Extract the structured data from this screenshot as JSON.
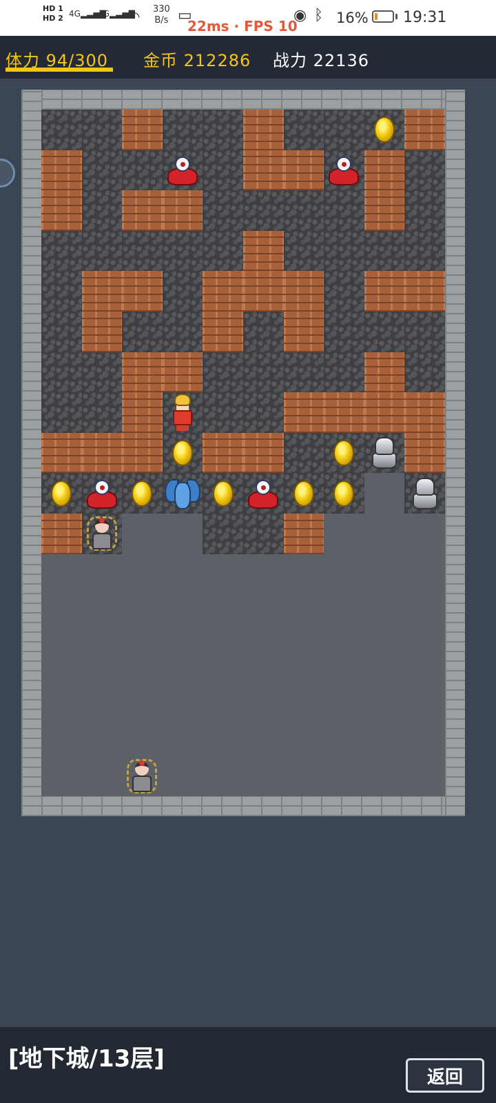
{
  "status_bar": {
    "hd_label_1": "HD 1",
    "hd_label_2": "HD 2",
    "signal_1": "4G",
    "signal_2": "4G",
    "net_speed_value": "330",
    "net_speed_unit": "B/s",
    "perf": "22ms · FPS 10",
    "battery_pct": "16%",
    "battery_level": 0.16,
    "time": "19:31",
    "icons": [
      "signal-icon",
      "wifi-icon",
      "cast-icon",
      "eye-icon",
      "bluetooth-icon",
      "battery-icon"
    ]
  },
  "hud": {
    "stamina_label": "体力",
    "stamina_value": "94/300",
    "gold_label": "金币",
    "gold_value": "212286",
    "power_label": "战力",
    "power_value": "22136",
    "accent_color": "#f4c418"
  },
  "map": {
    "cols": 10,
    "rows": 17,
    "legend": {
      "C": "cobblestone floor",
      "B": "brick wall",
      ".": "empty floor"
    },
    "grid": [
      "CCBCCBCCCB",
      "BCCCCBBCBC",
      "BCBBCCCCBC",
      "CCCCCBCCCC",
      "CBBCBBBCBB",
      "CBCCBCBCCC",
      "CCBBCCCCBC",
      "CCBCCCBBBB",
      "BBBCBBCCCB",
      "CCCCCCCC.C",
      "BC..CCB...",
      "..........",
      "..........",
      "..........",
      "..........",
      "..........",
      ".........."
    ],
    "sprites": [
      {
        "kind": "coin",
        "col": 8,
        "row": 0
      },
      {
        "kind": "slime",
        "col": 3,
        "row": 1
      },
      {
        "kind": "slime",
        "col": 7,
        "row": 1
      },
      {
        "kind": "hero",
        "col": 3,
        "row": 7
      },
      {
        "kind": "coin",
        "col": 3,
        "row": 8
      },
      {
        "kind": "coin",
        "col": 7,
        "row": 8
      },
      {
        "kind": "knight",
        "col": 8,
        "row": 8
      },
      {
        "kind": "coin",
        "col": 0,
        "row": 9
      },
      {
        "kind": "slime",
        "col": 1,
        "row": 9
      },
      {
        "kind": "coin",
        "col": 2,
        "row": 9
      },
      {
        "kind": "dragon",
        "col": 3,
        "row": 9
      },
      {
        "kind": "coin",
        "col": 4,
        "row": 9
      },
      {
        "kind": "slime",
        "col": 5,
        "row": 9
      },
      {
        "kind": "coin",
        "col": 6,
        "row": 9
      },
      {
        "kind": "coin",
        "col": 7,
        "row": 9
      },
      {
        "kind": "knight",
        "col": 9,
        "row": 9
      },
      {
        "kind": "maiden",
        "col": 1,
        "row": 10
      },
      {
        "kind": "maiden",
        "col": 2,
        "row": 16
      }
    ]
  },
  "footer": {
    "floor_label": "[地下城/13层]",
    "back_label": "返回"
  }
}
